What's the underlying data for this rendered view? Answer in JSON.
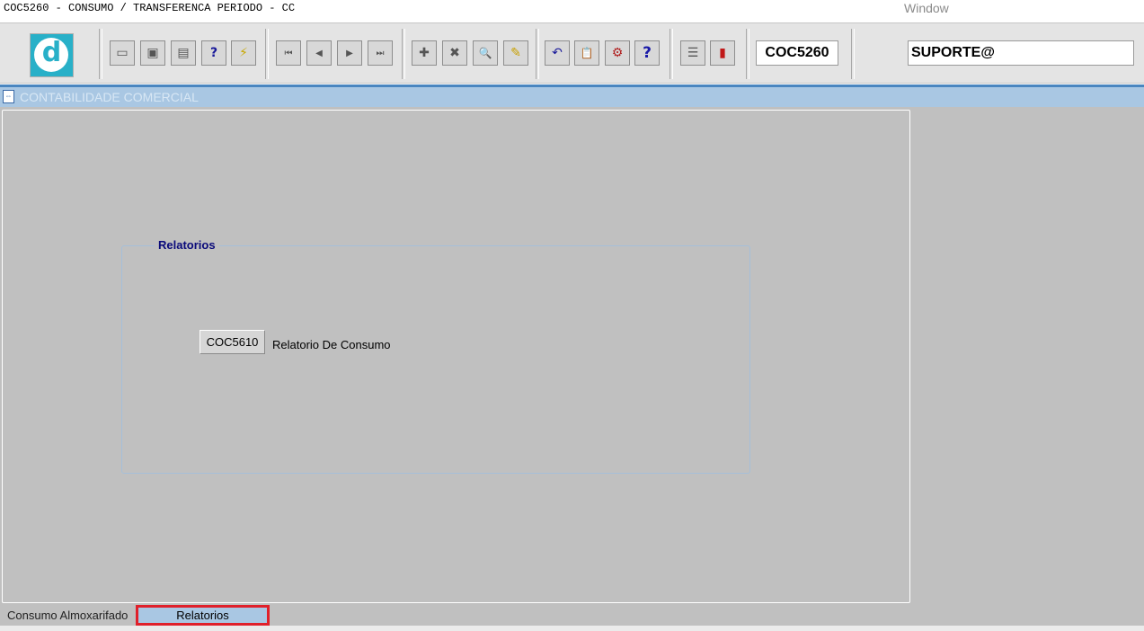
{
  "window": {
    "title": "COC5260 - CONSUMO / TRANSFERENCA PERIODO - CC",
    "menu_window": "Window"
  },
  "toolbar": {
    "logo_letter": "d",
    "buttons": [
      {
        "name": "save-icon",
        "glyph": "▭"
      },
      {
        "name": "screen-icon",
        "glyph": "▣"
      },
      {
        "name": "print-icon",
        "glyph": "▤"
      },
      {
        "name": "query-help-icon",
        "glyph": "?"
      },
      {
        "name": "execute-query-icon",
        "glyph": "⚡"
      },
      {
        "name": "first-record-icon",
        "glyph": "⏮"
      },
      {
        "name": "previous-record-icon",
        "glyph": "◀"
      },
      {
        "name": "next-record-icon",
        "glyph": "▶"
      },
      {
        "name": "last-record-icon",
        "glyph": "⏭"
      },
      {
        "name": "insert-record-icon",
        "glyph": "✚"
      },
      {
        "name": "delete-record-icon",
        "glyph": "✖"
      },
      {
        "name": "edit-search-icon",
        "glyph": "🔍"
      },
      {
        "name": "clear-pencil-icon",
        "glyph": "✎"
      },
      {
        "name": "undo-icon",
        "glyph": "↶"
      },
      {
        "name": "clipboard-icon",
        "glyph": "📋"
      },
      {
        "name": "tools-icon",
        "glyph": "⚙"
      },
      {
        "name": "help-icon",
        "glyph": "?"
      },
      {
        "name": "menu-icon",
        "glyph": "☰"
      },
      {
        "name": "exit-door-icon",
        "glyph": "▮"
      }
    ],
    "form_code": "COC5260",
    "user": "SUPORTE@"
  },
  "header": {
    "title": "CONTABILIDADE COMERCIAL"
  },
  "group": {
    "title": "Relatorios",
    "report_button": "COC5610",
    "report_label": "Relatorio De Consumo"
  },
  "tabs": [
    {
      "label": "Consumo Almoxarifado",
      "active": false
    },
    {
      "label": "Relatorios",
      "active": true
    }
  ],
  "colors": {
    "header_bar": "#a9c7e3",
    "canvas": "#c0c0c0",
    "group_title": "#0a0a7a",
    "tab_highlight": "#e0202a",
    "logo": "#28b0c8"
  }
}
